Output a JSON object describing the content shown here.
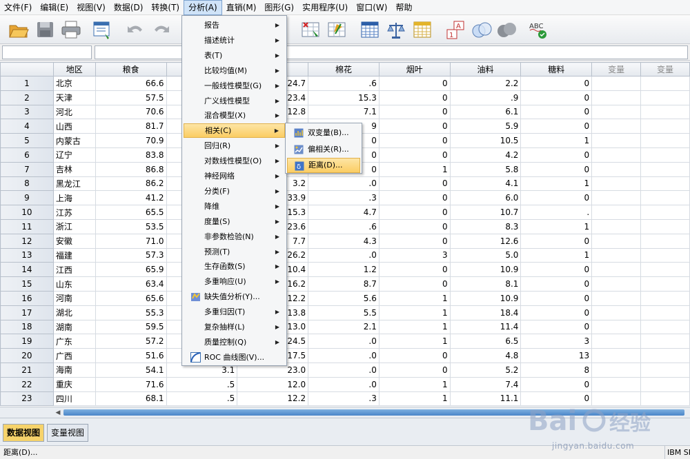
{
  "menubar": {
    "items": [
      "文件(F)",
      "编辑(E)",
      "视图(V)",
      "数据(D)",
      "转换(T)",
      "分析(A)",
      "直销(M)",
      "图形(G)",
      "实用程序(U)",
      "窗口(W)",
      "帮助"
    ]
  },
  "toolbar": {
    "icons": [
      "open-folder-icon",
      "save-icon",
      "print-icon",
      "dialog-recall-icon",
      "undo-icon",
      "redo-icon",
      "find-icon",
      "insert-cases-icon",
      "split-file-icon",
      "weight-cases-icon",
      "select-cases-icon",
      "value-labels-icon",
      "use-variable-sets-icon",
      "show-all-variables-icon",
      "spell-check-icon"
    ],
    "spell_label": "ABC"
  },
  "colors": {
    "menu_highlight": "#fbcd63",
    "active_tab": "#f6d36b",
    "scroll_thumb": "#4a86c8"
  },
  "grid": {
    "columns": [
      "地区",
      "粮食",
      "",
      "",
      "棉花",
      "烟叶",
      "油料",
      "糖料",
      "变量",
      "变量"
    ],
    "rows": [
      {
        "n": "1",
        "cells": [
          "北京",
          "66.6",
          "",
          "24.7",
          ".6",
          "0",
          "2.2",
          "0"
        ]
      },
      {
        "n": "2",
        "cells": [
          "天津",
          "57.5",
          "",
          "23.4",
          "15.3",
          "0",
          ".9",
          "0"
        ]
      },
      {
        "n": "3",
        "cells": [
          "河北",
          "70.6",
          "",
          "12.8",
          "7.1",
          "0",
          "6.1",
          "0"
        ]
      },
      {
        "n": "4",
        "cells": [
          "山西",
          "81.7",
          "",
          "",
          "9",
          "0",
          "5.9",
          "0"
        ]
      },
      {
        "n": "5",
        "cells": [
          "内蒙古",
          "70.9",
          "",
          "",
          "0",
          "0",
          "10.5",
          "1"
        ]
      },
      {
        "n": "6",
        "cells": [
          "辽宁",
          "83.8",
          "",
          "",
          "0",
          "0",
          "4.2",
          "0"
        ]
      },
      {
        "n": "7",
        "cells": [
          "吉林",
          "86.8",
          "",
          "",
          "0",
          "1",
          "5.8",
          "0"
        ]
      },
      {
        "n": "8",
        "cells": [
          "黑龙江",
          "86.2",
          "",
          "3.2",
          ".0",
          "0",
          "4.1",
          "1"
        ]
      },
      {
        "n": "9",
        "cells": [
          "上海",
          "41.2",
          "",
          "33.9",
          ".3",
          "0",
          "6.0",
          "0"
        ]
      },
      {
        "n": "10",
        "cells": [
          "江苏",
          "65.5",
          "",
          "15.3",
          "4.7",
          "0",
          "10.7",
          "."
        ]
      },
      {
        "n": "11",
        "cells": [
          "浙江",
          "53.5",
          "",
          "23.6",
          ".6",
          "0",
          "8.3",
          "1"
        ]
      },
      {
        "n": "12",
        "cells": [
          "安徽",
          "71.0",
          "",
          "7.7",
          "4.3",
          "0",
          "12.6",
          "0"
        ]
      },
      {
        "n": "13",
        "cells": [
          "福建",
          "57.3",
          "",
          "26.2",
          ".0",
          "3",
          "5.0",
          "1"
        ]
      },
      {
        "n": "14",
        "cells": [
          "江西",
          "65.9",
          "",
          "10.4",
          "1.2",
          "0",
          "10.9",
          "0"
        ]
      },
      {
        "n": "15",
        "cells": [
          "山东",
          "63.4",
          "",
          "16.2",
          "8.7",
          "0",
          "8.1",
          "0"
        ]
      },
      {
        "n": "16",
        "cells": [
          "河南",
          "65.6",
          "",
          "12.2",
          "5.6",
          "1",
          "10.9",
          "0"
        ]
      },
      {
        "n": "17",
        "cells": [
          "湖北",
          "55.3",
          "",
          "13.8",
          "5.5",
          "1",
          "18.4",
          "0"
        ]
      },
      {
        "n": "18",
        "cells": [
          "湖南",
          "59.5",
          "",
          "13.0",
          "2.1",
          "1",
          "11.4",
          "0"
        ]
      },
      {
        "n": "19",
        "cells": [
          "广东",
          "57.2",
          "",
          "24.5",
          ".0",
          "1",
          "6.5",
          "3"
        ]
      },
      {
        "n": "20",
        "cells": [
          "广西",
          "51.6",
          "",
          "17.5",
          ".0",
          "0",
          "4.8",
          "13"
        ]
      },
      {
        "n": "21",
        "cells": [
          "海南",
          "54.1",
          "3.1",
          "23.0",
          ".0",
          "0",
          "5.2",
          "8"
        ]
      },
      {
        "n": "22",
        "cells": [
          "重庆",
          "71.6",
          ".5",
          "12.0",
          ".0",
          "1",
          "7.4",
          "0"
        ]
      },
      {
        "n": "23",
        "cells": [
          "四川",
          "68.1",
          ".5",
          "12.2",
          ".3",
          "1",
          "11.1",
          "0"
        ]
      }
    ]
  },
  "analyze_menu": {
    "items": [
      {
        "label": "报告",
        "sub": true
      },
      {
        "label": "描述统计",
        "sub": true
      },
      {
        "label": "表(T)",
        "sub": true
      },
      {
        "label": "比较均值(M)",
        "sub": true
      },
      {
        "label": "一般线性模型(G)",
        "sub": true
      },
      {
        "label": "广义线性模型",
        "sub": true
      },
      {
        "label": "混合模型(X)",
        "sub": true
      },
      {
        "label": "相关(C)",
        "sub": true,
        "highlight": true
      },
      {
        "label": "回归(R)",
        "sub": true
      },
      {
        "label": "对数线性模型(O)",
        "sub": true
      },
      {
        "label": "神经网络",
        "sub": true
      },
      {
        "label": "分类(F)",
        "sub": true
      },
      {
        "label": "降维",
        "sub": true
      },
      {
        "label": "度量(S)",
        "sub": true
      },
      {
        "label": "非参数检验(N)",
        "sub": true
      },
      {
        "label": "预测(T)",
        "sub": true
      },
      {
        "label": "生存函数(S)",
        "sub": true
      },
      {
        "label": "多重响应(U)",
        "sub": true
      },
      {
        "label": "缺失值分析(Y)...",
        "sub": false,
        "icon": "missing-value-icon"
      },
      {
        "label": "多重归因(T)",
        "sub": true
      },
      {
        "label": "复杂抽样(L)",
        "sub": true
      },
      {
        "label": "质量控制(Q)",
        "sub": true
      },
      {
        "label": "ROC 曲线图(V)...",
        "sub": false,
        "icon": "roc-curve-icon"
      }
    ]
  },
  "correlate_menu": {
    "items": [
      {
        "label": "双变量(B)...",
        "icon": "bivariate-icon"
      },
      {
        "label": "偏相关(R)...",
        "icon": "partial-correlation-icon"
      },
      {
        "label": "距离(D)...",
        "icon": "distance-icon",
        "highlight": true
      }
    ]
  },
  "tabs": {
    "data_view": "数据视图",
    "variable_view": "变量视图"
  },
  "status": {
    "left": "距离(D)...",
    "right": "IBM SPSS"
  },
  "watermark": {
    "logo": "Baidu 经验",
    "url": "jingyan.baidu.com"
  }
}
